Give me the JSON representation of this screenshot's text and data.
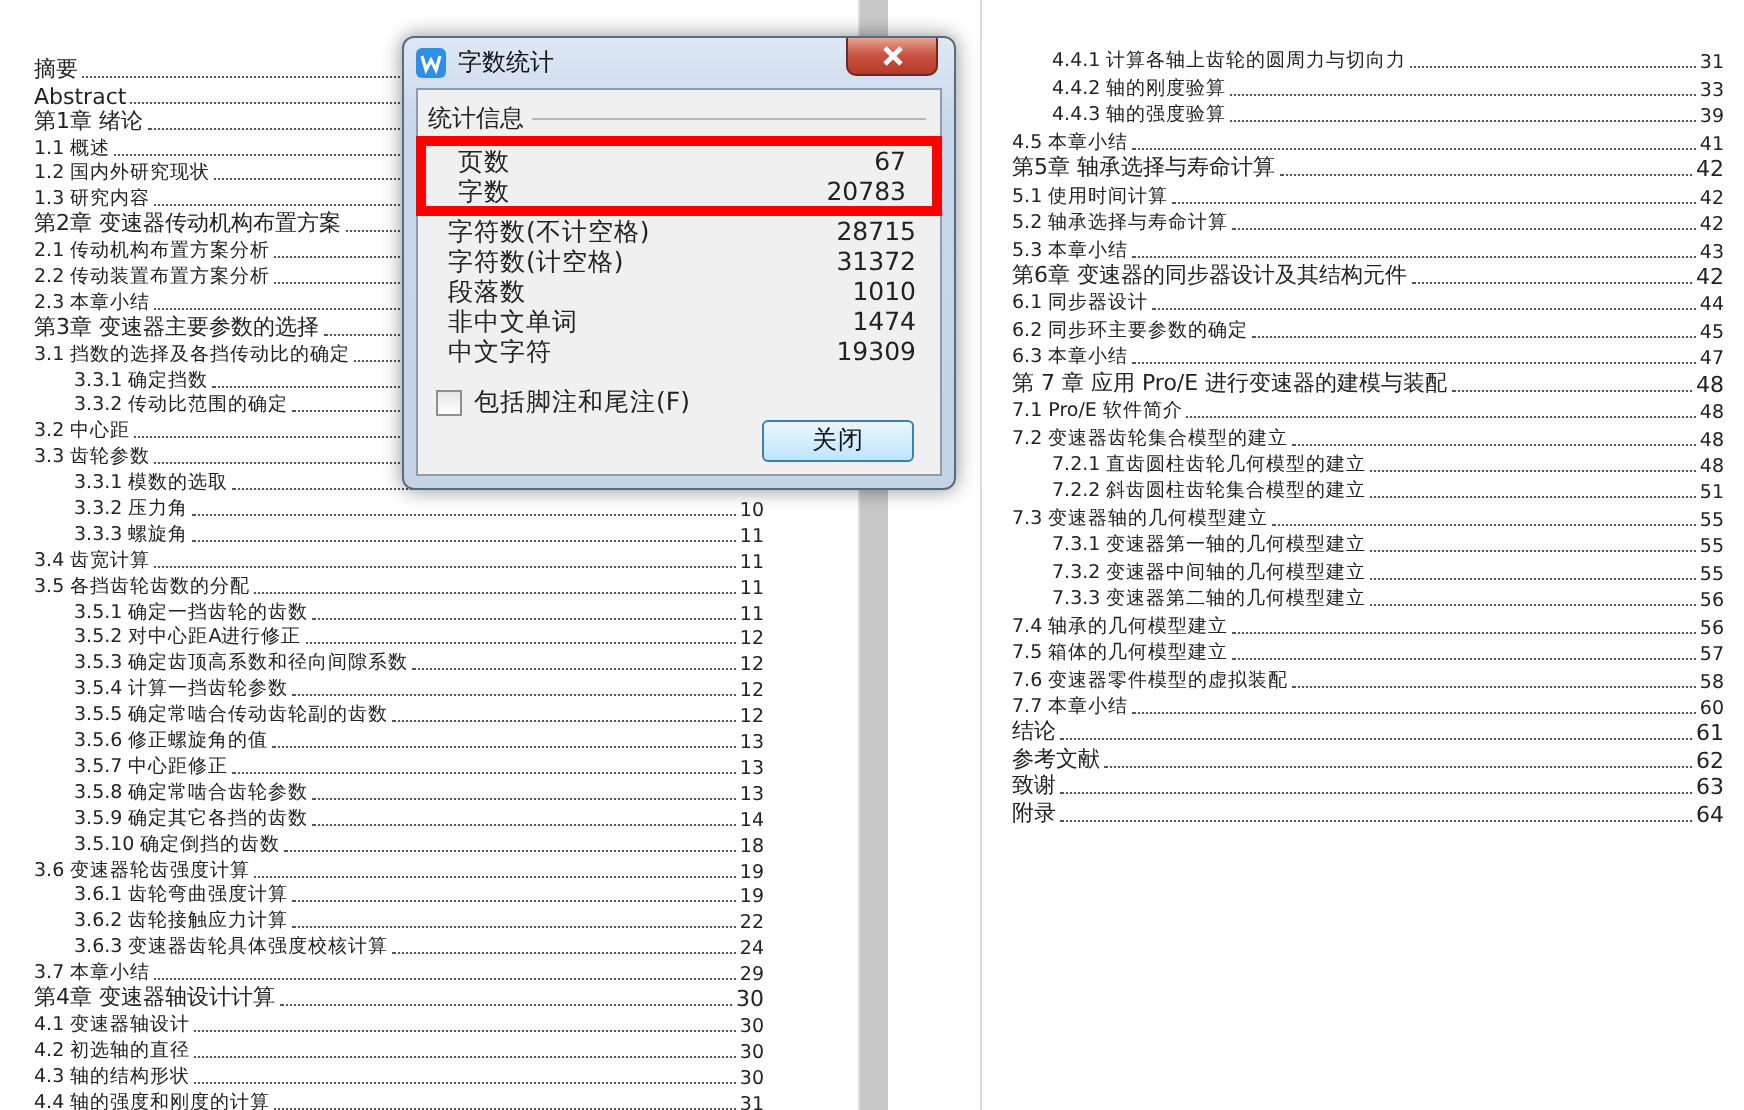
{
  "document": {
    "left_page": {
      "entries": [
        {
          "title": "摘要"
        },
        {
          "title": "Abstract"
        },
        {
          "title": "第1章  绪论",
          "children": [
            {
              "title": "1.1 概述"
            },
            {
              "title": "1.2 国内外研究现状"
            },
            {
              "title": "1.3  研究内容"
            }
          ]
        },
        {
          "title": "第2章  变速器传动机构布置方案",
          "children": [
            {
              "title": "2.1 传动机构布置方案分析"
            },
            {
              "title": "2.2 传动装置布置方案分析"
            },
            {
              "title": "2.3 本章小结"
            }
          ]
        },
        {
          "title": "第3章  变速器主要参数的选择",
          "children": [
            {
              "title": "3.1 挡数的选择及各挡传动比的确定",
              "children": [
                {
                  "title": "3.3.1 确定挡数"
                },
                {
                  "title": "3.3.2 传动比范围的确定"
                }
              ]
            },
            {
              "title": "3.2 中心距"
            },
            {
              "title": "3.3 齿轮参数",
              "children": [
                {
                  "title": "3.3.1 模数的选取"
                },
                {
                  "title": "3.3.2 压力角",
                  "page": "10"
                },
                {
                  "title": "3.3.3 螺旋角",
                  "page": "11"
                }
              ]
            },
            {
              "title": "3.4 齿宽计算",
              "page": "11"
            },
            {
              "title": "3.5 各挡齿轮齿数的分配",
              "page": "11",
              "children": [
                {
                  "title": "3.5.1 确定一挡齿轮的齿数",
                  "page": "11"
                },
                {
                  "title": "3.5.2 对中心距A进行修正",
                  "page": "12"
                },
                {
                  "title": "3.5.3 确定齿顶高系数和径向间隙系数",
                  "page": "12"
                },
                {
                  "title": "3.5.4 计算一挡齿轮参数",
                  "page": "12"
                },
                {
                  "title": "3.5.5 确定常啮合传动齿轮副的齿数",
                  "page": "12"
                },
                {
                  "title": "3.5.6 修正螺旋角的值",
                  "page": "13"
                },
                {
                  "title": "3.5.7 中心距修正",
                  "page": "13"
                },
                {
                  "title": "3.5.8 确定常啮合齿轮参数",
                  "page": "13"
                },
                {
                  "title": "3.5.9 确定其它各挡的齿数",
                  "page": "14"
                },
                {
                  "title": "3.5.10  确定倒挡的齿数",
                  "page": "18"
                }
              ]
            },
            {
              "title": "3.6 变速器轮齿强度计算",
              "page": "19",
              "children": [
                {
                  "title": "3.6.1 齿轮弯曲强度计算",
                  "page": "19"
                },
                {
                  "title": "3.6.2 齿轮接触应力计算",
                  "page": "22"
                },
                {
                  "title": "3.6.3 变速器齿轮具体强度校核计算",
                  "page": "24"
                }
              ]
            },
            {
              "title": "3.7 本章小结",
              "page": "29"
            }
          ]
        },
        {
          "title": "第4章  变速器轴设计计算",
          "page": "30",
          "children": [
            {
              "title": "4.1 变速器轴设计",
              "page": "30"
            },
            {
              "title": "4.2 初选轴的直径",
              "page": "30"
            },
            {
              "title": "4.3 轴的结构形状",
              "page": "30"
            },
            {
              "title": "4.4 轴的强度和刚度的计算",
              "page": "31"
            }
          ]
        }
      ]
    },
    "right_page": {
      "entries": [
        {
          "children": [
            {
              "children": [
                {
                  "title": "4.4.1 计算各轴上齿轮的圆周力与切向力",
                  "page": "31"
                },
                {
                  "title": "4.4.2 轴的刚度验算",
                  "page": "33"
                },
                {
                  "title": "4.4.3 轴的强度验算",
                  "page": "39"
                }
              ]
            },
            {
              "title": "4.5 本章小结",
              "page": "41"
            }
          ]
        },
        {
          "title": "第5章  轴承选择与寿命计算",
          "page": "42",
          "children": [
            {
              "title": "5.1 使用时间计算",
              "page": "42"
            },
            {
              "title": "5.2 轴承选择与寿命计算",
              "page": "42"
            },
            {
              "title": "5.3 本章小结",
              "page": "43"
            }
          ]
        },
        {
          "title": "第6章  变速器的同步器设计及其结构元件",
          "page": "42",
          "children": [
            {
              "title": "6.1 同步器设计",
              "page": "44"
            },
            {
              "title": "6.2 同步环主要参数的确定",
              "page": "45"
            },
            {
              "title": "6.3 本章小结",
              "page": "47"
            }
          ]
        },
        {
          "title": "第 7 章  应用 Pro/E 进行变速器的建模与装配",
          "page": "48",
          "children": [
            {
              "title": "7.1 Pro/E 软件简介",
              "page": "48"
            },
            {
              "title": "7.2 变速器齿轮集合模型的建立",
              "page": "48",
              "children": [
                {
                  "title": "7.2.1 直齿圆柱齿轮几何模型的建立",
                  "page": "48"
                },
                {
                  "title": "7.2.2 斜齿圆柱齿轮集合模型的建立",
                  "page": "51"
                }
              ]
            },
            {
              "title": "7.3 变速器轴的几何模型建立",
              "page": "55",
              "children": [
                {
                  "title": "7.3.1 变速器第一轴的几何模型建立",
                  "page": "55"
                },
                {
                  "title": "7.3.2 变速器中间轴的几何模型建立",
                  "page": "55"
                },
                {
                  "title": "7.3.3 变速器第二轴的几何模型建立",
                  "page": "56"
                }
              ]
            },
            {
              "title": "7.4 轴承的几何模型建立",
              "page": "56"
            },
            {
              "title": "7.5 箱体的几何模型建立",
              "page": "57"
            },
            {
              "title": "7.6 变速器零件模型的虚拟装配",
              "page": "58"
            },
            {
              "title": "7.7 本章小结",
              "page": "60"
            }
          ]
        },
        {
          "title": "结论",
          "page": "61"
        },
        {
          "title": "参考文献",
          "page": "62"
        },
        {
          "title": "致谢",
          "page": "63"
        },
        {
          "title": "附录",
          "page": "64"
        }
      ]
    }
  },
  "dialog": {
    "title": "字数统计",
    "group_label": "统计信息",
    "stats": [
      {
        "label": "页数",
        "value": "67",
        "highlighted": true
      },
      {
        "label": "字数",
        "value": "20783",
        "highlighted": true
      },
      {
        "label": "字符数(不计空格)",
        "value": "28715",
        "highlighted": false
      },
      {
        "label": "字符数(计空格)",
        "value": "31372",
        "highlighted": false
      },
      {
        "label": "段落数",
        "value": "1010",
        "highlighted": false
      },
      {
        "label": "非中文单词",
        "value": "1474",
        "highlighted": false
      },
      {
        "label": "中文字符",
        "value": "19309",
        "highlighted": false
      }
    ],
    "checkbox": {
      "label": "包括脚注和尾注(F)",
      "checked": false
    },
    "close_button": "关闭"
  }
}
